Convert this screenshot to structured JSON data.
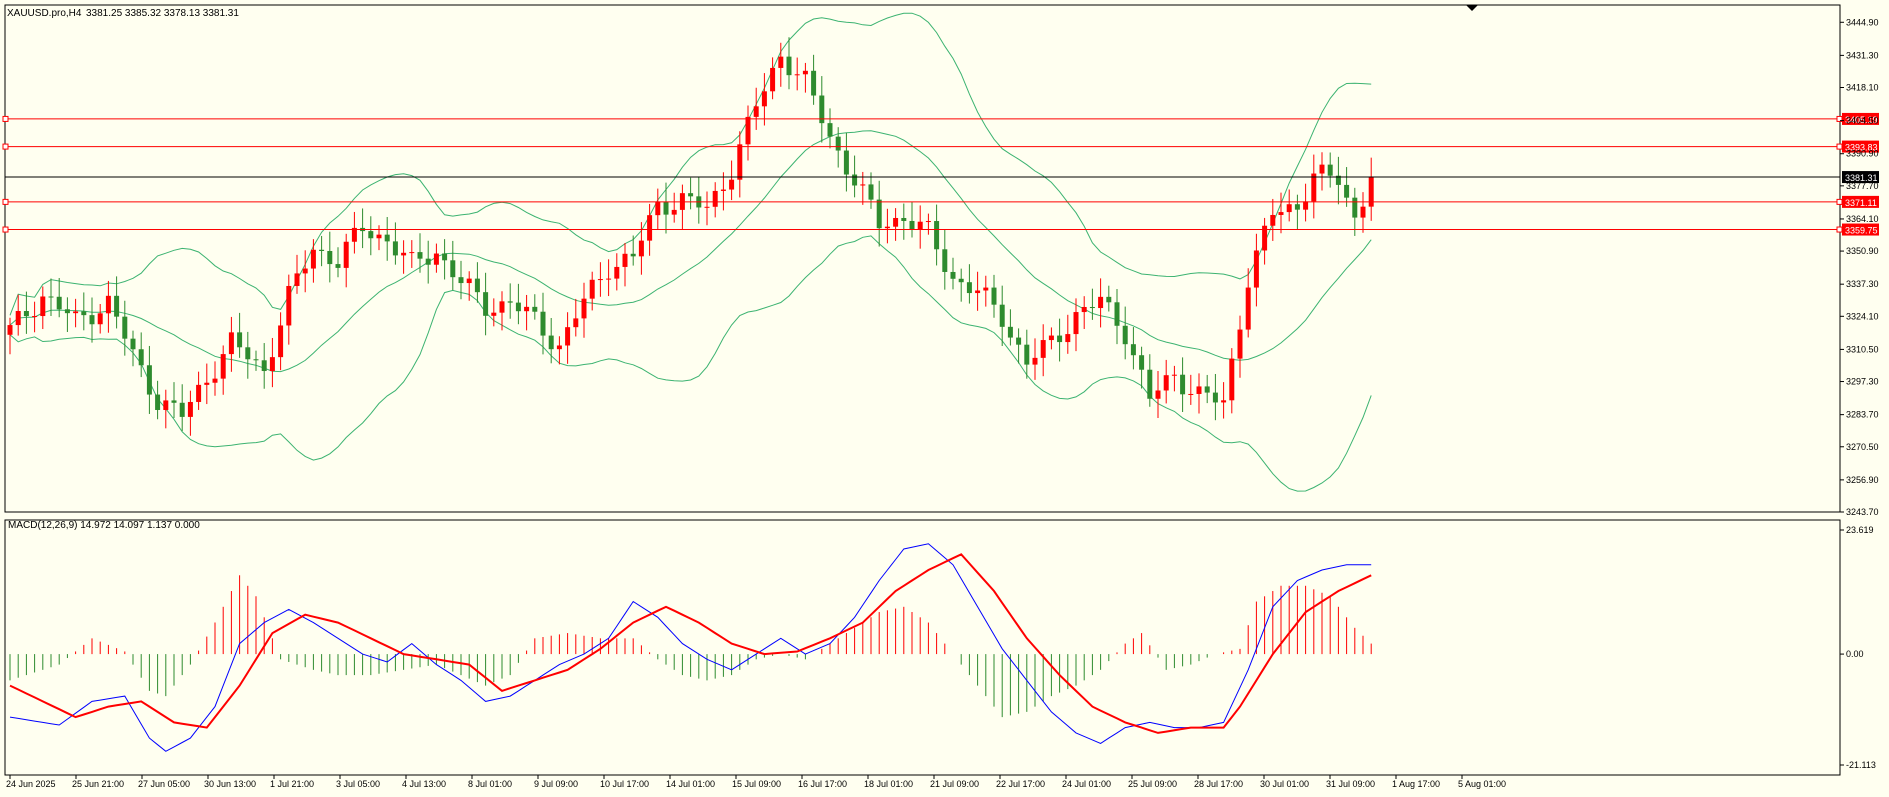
{
  "header": {
    "symbol": "XAUUSD.pro,H4",
    "ohlc": "3381.25 3385.32 3378.13 3381.31",
    "macd_label": "MACD(12,26,9) 14.972 14.097 1.137 0.000"
  },
  "colors": {
    "background": "#fffff0",
    "bull_candle": "#ff0000",
    "bear_candle": "#2e8b2e",
    "bollinger": "#3cb371",
    "level_line": "#ff0000",
    "price_line": "#000000",
    "macd_line": "#0000ff",
    "signal_line": "#ff0000",
    "hist_pos": "#ff0000",
    "hist_neg": "#2e8b2e"
  },
  "chart_data": [
    {
      "type": "candlestick",
      "title": "XAUUSD.pro,H4",
      "ylim": [
        3243.7,
        3452.0
      ],
      "y_ticks": [
        "3444.90",
        "3431.30",
        "3418.10",
        "3404.50",
        "3390.90",
        "3377.70",
        "3364.10",
        "3350.90",
        "3337.30",
        "3324.10",
        "3310.50",
        "3297.30",
        "3283.70",
        "3270.50",
        "3256.90",
        "3243.70"
      ],
      "x_labels": [
        "24 Jun 2025",
        "25 Jun 21:00",
        "27 Jun 05:00",
        "30 Jun 13:00",
        "1 Jul 21:00",
        "3 Jul 05:00",
        "4 Jul 13:00",
        "8 Jul 01:00",
        "9 Jul 09:00",
        "10 Jul 17:00",
        "14 Jul 01:00",
        "15 Jul 09:00",
        "16 Jul 17:00",
        "18 Jul 01:00",
        "21 Jul 09:00",
        "22 Jul 17:00",
        "24 Jul 01:00",
        "25 Jul 09:00",
        "28 Jul 17:00",
        "30 Jul 01:00",
        "31 Jul 09:00",
        "1 Aug 17:00",
        "5 Aug 01:00"
      ],
      "current_price": 3381.31,
      "current_price_label": "3381.31",
      "horizontal_levels": [
        3405.19,
        3393.83,
        3371.11,
        3359.75
      ],
      "horizontal_level_labels": [
        "3405.19",
        "3393.83",
        "3371.11",
        "3359.75"
      ],
      "close_path": [
        [
          0,
          3318
        ],
        [
          4,
          3333
        ],
        [
          8,
          3322
        ],
        [
          12,
          3330
        ],
        [
          15,
          3308
        ],
        [
          18,
          3290
        ],
        [
          21,
          3283
        ],
        [
          24,
          3299
        ],
        [
          27,
          3313
        ],
        [
          31,
          3302
        ],
        [
          34,
          3332
        ],
        [
          37,
          3352
        ],
        [
          40,
          3347
        ],
        [
          43,
          3360
        ],
        [
          46,
          3356
        ],
        [
          49,
          3345
        ],
        [
          52,
          3351
        ],
        [
          55,
          3338
        ],
        [
          58,
          3328
        ],
        [
          61,
          3330
        ],
        [
          64,
          3322
        ],
        [
          67,
          3312
        ],
        [
          70,
          3330
        ],
        [
          73,
          3345
        ],
        [
          76,
          3348
        ],
        [
          79,
          3370
        ],
        [
          82,
          3372
        ],
        [
          85,
          3368
        ],
        [
          88,
          3385
        ],
        [
          91,
          3410
        ],
        [
          94,
          3432
        ],
        [
          97,
          3420
        ],
        [
          100,
          3398
        ],
        [
          103,
          3380
        ],
        [
          106,
          3362
        ],
        [
          109,
          3365
        ],
        [
          112,
          3358
        ],
        [
          115,
          3340
        ],
        [
          118,
          3334
        ],
        [
          121,
          3324
        ],
        [
          124,
          3305
        ],
        [
          127,
          3313
        ],
        [
          130,
          3325
        ],
        [
          133,
          3330
        ],
        [
          136,
          3318
        ],
        [
          139,
          3290
        ],
        [
          142,
          3300
        ],
        [
          145,
          3292
        ],
        [
          148,
          3288
        ],
        [
          151,
          3340
        ],
        [
          154,
          3366
        ],
        [
          157,
          3370
        ],
        [
          159,
          3382
        ],
        [
          162,
          3380
        ],
        [
          164,
          3365
        ],
        [
          166,
          3381.31
        ]
      ]
    },
    {
      "type": "line",
      "title": "MACD(12,26,9)",
      "ylim": [
        -21.113,
        23.619
      ],
      "y_ticks": [
        "23.619",
        "0.00",
        "-21.113"
      ],
      "macd_path": [
        [
          0,
          -12
        ],
        [
          6,
          -13.5
        ],
        [
          10,
          -9
        ],
        [
          14,
          -8
        ],
        [
          17,
          -16
        ],
        [
          19,
          -18.5
        ],
        [
          22,
          -16
        ],
        [
          25,
          -10
        ],
        [
          28,
          2
        ],
        [
          31,
          6
        ],
        [
          34,
          8.5
        ],
        [
          37,
          6
        ],
        [
          40,
          3
        ],
        [
          43,
          0
        ],
        [
          46,
          -1.5
        ],
        [
          49,
          2
        ],
        [
          52,
          -2
        ],
        [
          55,
          -5
        ],
        [
          58,
          -9
        ],
        [
          61,
          -8
        ],
        [
          64,
          -5
        ],
        [
          67,
          -2
        ],
        [
          70,
          0
        ],
        [
          73,
          3
        ],
        [
          76,
          10
        ],
        [
          79,
          7
        ],
        [
          82,
          2
        ],
        [
          85,
          -1
        ],
        [
          88,
          -3
        ],
        [
          91,
          0
        ],
        [
          94,
          3
        ],
        [
          97,
          0
        ],
        [
          100,
          2
        ],
        [
          103,
          7
        ],
        [
          106,
          14
        ],
        [
          109,
          20
        ],
        [
          112,
          21
        ],
        [
          115,
          17
        ],
        [
          118,
          9
        ],
        [
          121,
          1
        ],
        [
          124,
          -5
        ],
        [
          127,
          -11
        ],
        [
          130,
          -15
        ],
        [
          133,
          -17
        ],
        [
          136,
          -14
        ],
        [
          139,
          -13
        ],
        [
          142,
          -14
        ],
        [
          145,
          -14
        ],
        [
          148,
          -13
        ],
        [
          151,
          -3
        ],
        [
          154,
          9
        ],
        [
          157,
          14
        ],
        [
          160,
          16
        ],
        [
          163,
          17
        ],
        [
          166,
          17
        ]
      ],
      "signal_path": [
        [
          0,
          -6
        ],
        [
          4,
          -9
        ],
        [
          8,
          -12
        ],
        [
          12,
          -10
        ],
        [
          16,
          -9
        ],
        [
          20,
          -13
        ],
        [
          24,
          -14
        ],
        [
          28,
          -6
        ],
        [
          32,
          4
        ],
        [
          36,
          7.5
        ],
        [
          40,
          6
        ],
        [
          44,
          3
        ],
        [
          48,
          0
        ],
        [
          52,
          -1
        ],
        [
          56,
          -2
        ],
        [
          60,
          -7
        ],
        [
          64,
          -5
        ],
        [
          68,
          -3
        ],
        [
          72,
          1
        ],
        [
          76,
          6
        ],
        [
          80,
          9
        ],
        [
          84,
          6
        ],
        [
          88,
          2
        ],
        [
          92,
          0
        ],
        [
          96,
          0.5
        ],
        [
          100,
          3
        ],
        [
          104,
          6
        ],
        [
          108,
          12
        ],
        [
          112,
          16
        ],
        [
          116,
          19
        ],
        [
          120,
          12
        ],
        [
          124,
          3
        ],
        [
          128,
          -4
        ],
        [
          132,
          -10
        ],
        [
          136,
          -13
        ],
        [
          140,
          -15
        ],
        [
          144,
          -14
        ],
        [
          148,
          -14
        ],
        [
          150,
          -10
        ],
        [
          154,
          0
        ],
        [
          158,
          8
        ],
        [
          162,
          12
        ],
        [
          166,
          15
        ]
      ],
      "histogram_path": [
        [
          0,
          -5
        ],
        [
          6,
          -2
        ],
        [
          10,
          3
        ],
        [
          14,
          0.5
        ],
        [
          17,
          -7
        ],
        [
          19,
          -8
        ],
        [
          22,
          -2
        ],
        [
          25,
          6
        ],
        [
          28,
          15
        ],
        [
          30,
          11
        ],
        [
          33,
          -1
        ],
        [
          37,
          -3
        ],
        [
          40,
          -4
        ],
        [
          44,
          -4
        ],
        [
          48,
          -3
        ],
        [
          52,
          -2
        ],
        [
          55,
          -4
        ],
        [
          58,
          -6
        ],
        [
          61,
          -4
        ],
        [
          64,
          3
        ],
        [
          68,
          4
        ],
        [
          72,
          3
        ],
        [
          76,
          3
        ],
        [
          79,
          -1
        ],
        [
          82,
          -4
        ],
        [
          85,
          -5
        ],
        [
          88,
          -4
        ],
        [
          91,
          -1
        ],
        [
          94,
          0
        ],
        [
          97,
          -1
        ],
        [
          100,
          2
        ],
        [
          103,
          5
        ],
        [
          106,
          8
        ],
        [
          109,
          9
        ],
        [
          112,
          6
        ],
        [
          115,
          0
        ],
        [
          118,
          -6
        ],
        [
          121,
          -12
        ],
        [
          124,
          -11
        ],
        [
          127,
          -8
        ],
        [
          130,
          -6
        ],
        [
          133,
          -3
        ],
        [
          136,
          2
        ],
        [
          138,
          4
        ],
        [
          141,
          -3
        ],
        [
          144,
          -2
        ],
        [
          147,
          0
        ],
        [
          150,
          1
        ],
        [
          152,
          10
        ],
        [
          155,
          13
        ],
        [
          158,
          13
        ],
        [
          161,
          11
        ],
        [
          164,
          5
        ],
        [
          166,
          2
        ]
      ]
    }
  ]
}
